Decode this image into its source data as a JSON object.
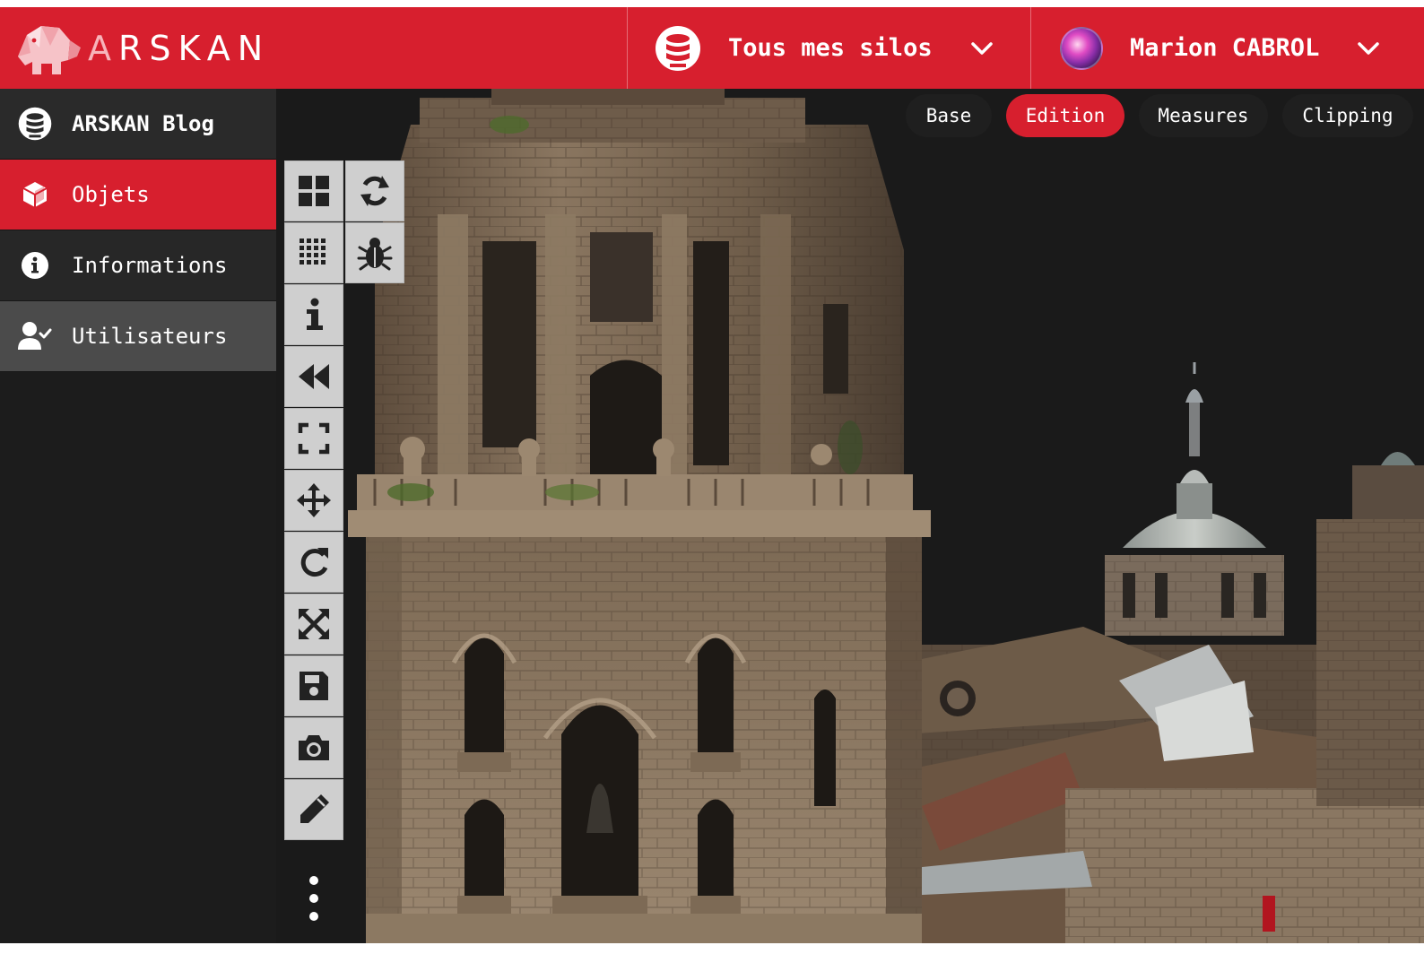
{
  "header": {
    "brand": {
      "initial": "A",
      "rest": "RSKAN"
    },
    "silo_selector": {
      "label": "Tous mes silos",
      "icon": "database-icon"
    },
    "user_menu": {
      "name": "Marion CABROL",
      "icon": "chevron-down-icon"
    }
  },
  "sidebar": {
    "project": {
      "label": "ARSKAN Blog",
      "icon": "database-icon"
    },
    "items": [
      {
        "label": "Objets",
        "icon": "cube-icon",
        "active": true
      },
      {
        "label": "Informations",
        "icon": "info-circle-icon",
        "active": false
      },
      {
        "label": "Utilisateurs",
        "icon": "user-check-icon",
        "active": false
      }
    ]
  },
  "viewer": {
    "tabs": [
      {
        "label": "Base",
        "active": false
      },
      {
        "label": "Edition",
        "active": true
      },
      {
        "label": "Measures",
        "active": false
      },
      {
        "label": "Clipping",
        "active": false
      }
    ],
    "toolbar": [
      "grid-large-icon",
      "sync-icon",
      "grid-small-icon",
      "bug-icon",
      "info-icon",
      "rewind-icon",
      "fullscreen-icon",
      "move-icon",
      "rotate-icon",
      "scale-icon",
      "save-icon",
      "camera-icon",
      "pencil-icon"
    ],
    "scene": "3D model of a cathedral bell tower"
  },
  "colors": {
    "primary": "#d71f2e",
    "sidebar": "#1c1c1c",
    "toolbar": "#cfcfcf"
  }
}
